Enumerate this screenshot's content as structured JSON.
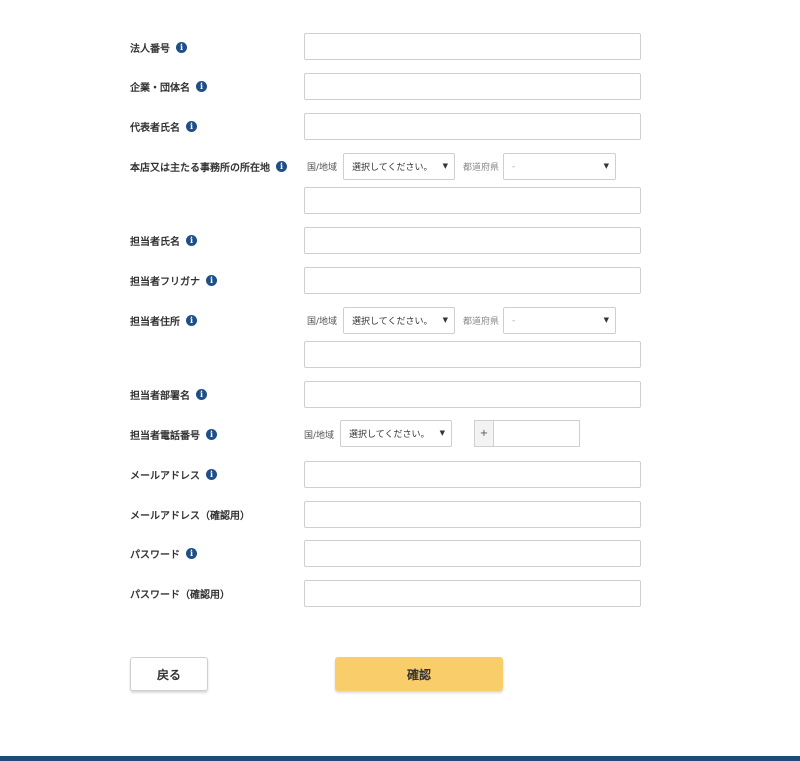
{
  "form": {
    "fields": [
      {
        "label": "法人番号",
        "info": true
      },
      {
        "label": "企業・団体名",
        "info": true
      },
      {
        "label": "代表者氏名",
        "info": true
      },
      {
        "label": "本店又は主たる事務所の所在地",
        "info": true
      },
      {
        "label": "担当者氏名",
        "info": true
      },
      {
        "label": "担当者フリガナ",
        "info": true
      },
      {
        "label": "担当者住所",
        "info": true
      },
      {
        "label": "担当者部署名",
        "info": true
      },
      {
        "label": "担当者電話番号",
        "info": true
      },
      {
        "label": "メールアドレス",
        "info": true
      },
      {
        "label": "メールアドレス（確認用）",
        "info": false
      },
      {
        "label": "パスワード",
        "info": true
      },
      {
        "label": "パスワード（確認用）",
        "info": false
      }
    ],
    "country_label": "国/地域",
    "prefecture_label": "都道府県",
    "country_select_value": "選択してください。",
    "prefecture_select_value": "-",
    "phone_prefix": "+",
    "info_glyph": "i",
    "select_arrow": "▼"
  },
  "buttons": {
    "back_label": "戻る",
    "confirm_label": "確認"
  },
  "colors": {
    "confirm_button": "#f9cd6a",
    "info_icon": "#1f4f86",
    "footer_bar": "#1e4c7a"
  }
}
